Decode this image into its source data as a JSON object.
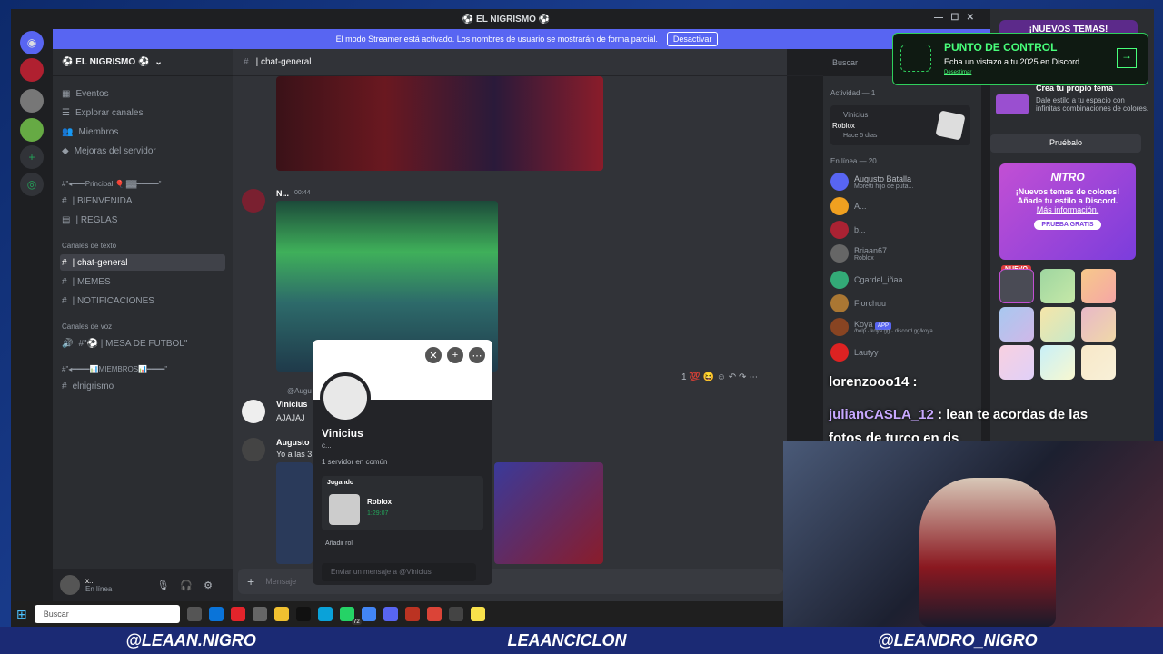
{
  "window": {
    "title": "⚽ EL NIGRISMO ⚽"
  },
  "streamer_banner": {
    "text": "El modo Streamer está activado. Los nombres de usuario se mostrarán de forma parcial.",
    "button": "Desactivar"
  },
  "server": {
    "name": "⚽ EL NIGRISMO ⚽"
  },
  "sidebar_top": [
    "Eventos",
    "Explorar canales",
    "Miembros",
    "Mejoras del servidor"
  ],
  "categories": {
    "principal": "#\"◂━━━Principal 🎈 ▓▓━━━━━\"",
    "texto": "Canales de texto",
    "voz": "Canales de voz",
    "miembros": "#\"◂━━━━📊MIEMBROS📊━━━━\""
  },
  "channels": {
    "bienvenida": "| BIENVENIDA",
    "reglas": "| REGLAS",
    "chat_general": "| chat-general",
    "memes": "| MEMES",
    "notificaciones": "| NOTIFICACIONES",
    "mesa": "#\"⚽ | MESA DE FUTBOL\"",
    "elnigrismo": "elnigrismo"
  },
  "chat_header": {
    "channel": "| chat-general",
    "search": "Buscar"
  },
  "messages": [
    {
      "author": "N...",
      "time": "00:44"
    },
    {
      "author": "Vinicius",
      "text": "AJAJAJ",
      "reply": "@Augu"
    },
    {
      "author": "Augusto",
      "text": "Yo a las 3"
    }
  ],
  "composer": {
    "placeholder": "Mensaje"
  },
  "popup": {
    "name": "Vinicius",
    "status": "c...",
    "mutual": "1 servidor en común",
    "activity_label": "Jugando",
    "game": "Roblox",
    "elapsed": "1:29:07",
    "add_role": "Añadir rol",
    "dm_placeholder": "Enviar un mensaje a @Vinicius"
  },
  "activity": {
    "header": "Actividad — 1",
    "user": "Vinicius",
    "game": "Roblox",
    "ago": "Hace 5 días"
  },
  "members": {
    "online_header": "En línea — 20",
    "list": [
      {
        "name": "Augusto Batalla",
        "sub": "Moretti hijo de puta..."
      },
      {
        "name": "A...",
        "sub": ""
      },
      {
        "name": "b...",
        "sub": ""
      },
      {
        "name": "Briaan67",
        "sub": "Roblox"
      },
      {
        "name": "Cgardel_iñaa",
        "sub": ""
      },
      {
        "name": "Florchuu",
        "sub": ""
      },
      {
        "name": "Koya",
        "sub": "/help · koya.gg · discord.gg/koya",
        "badge": "APP"
      },
      {
        "name": "Lautyy",
        "sub": ""
      }
    ]
  },
  "user_panel": {
    "name": "x...",
    "status": "En línea"
  },
  "right_panel": {
    "new_themes": "¡NUEVOS TEMAS!",
    "create_title": "Crea tu propio tema",
    "create_desc": "Dale estilo a tu espacio con infinitas combinaciones de colores.",
    "try": "Pruébalo",
    "nitro": "NITRO",
    "nitro_text": "¡Nuevos temas de colores! Añade tu estilo a Discord.",
    "nitro_link": "Más información.",
    "trial": "PRUEBA GRATIS",
    "new_badge": "NUEVO"
  },
  "toast": {
    "title": "PUNTO DE CONTROL",
    "text": "Echa un vistazo a tu 2025 en Discord.",
    "dismiss": "Desestimar"
  },
  "stream_chat": [
    {
      "user": "lorenzooo14",
      "msg": ""
    },
    {
      "user": "julianCASLA_12",
      "msg": "lean te acordas de las fotos de turco en ds"
    }
  ],
  "taskbar": {
    "search": "Buscar",
    "badge": "72"
  },
  "socials": [
    "@LEAAN.NIGRO",
    "LEAANCICLON",
    "@LEANDRO_NIGRO"
  ]
}
